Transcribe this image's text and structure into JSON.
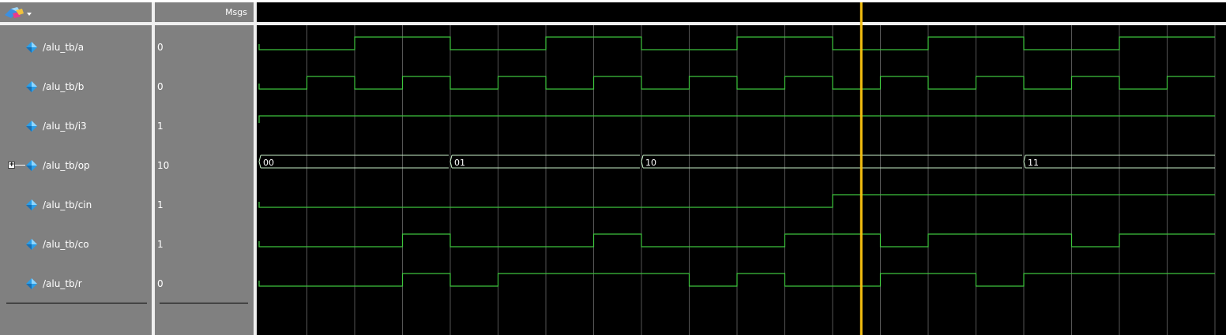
{
  "header": {
    "msgs_label": "Msgs"
  },
  "colors": {
    "wave": "#3ec43e",
    "cursor": "#f5bf10",
    "bus_line": "#c8f0c8",
    "grid": "#555555"
  },
  "time": {
    "start": 0,
    "end": 200,
    "cursor_time": 126,
    "grid_step": 10
  },
  "signals": [
    {
      "name": "/alu_tb/a",
      "value": "0",
      "type": "bit",
      "icon": "diamond-icon",
      "edges": [
        [
          0,
          0
        ],
        [
          20,
          1
        ],
        [
          40,
          0
        ],
        [
          60,
          1
        ],
        [
          80,
          0
        ],
        [
          100,
          1
        ],
        [
          120,
          0
        ],
        [
          140,
          1
        ],
        [
          160,
          0
        ],
        [
          180,
          1
        ]
      ]
    },
    {
      "name": "/alu_tb/b",
      "value": "0",
      "type": "bit",
      "icon": "diamond-icon",
      "edges": [
        [
          0,
          0
        ],
        [
          10,
          1
        ],
        [
          20,
          0
        ],
        [
          30,
          1
        ],
        [
          40,
          0
        ],
        [
          50,
          1
        ],
        [
          60,
          0
        ],
        [
          70,
          1
        ],
        [
          80,
          0
        ],
        [
          90,
          1
        ],
        [
          100,
          0
        ],
        [
          110,
          1
        ],
        [
          120,
          0
        ],
        [
          130,
          1
        ],
        [
          140,
          0
        ],
        [
          150,
          1
        ],
        [
          160,
          0
        ],
        [
          170,
          1
        ],
        [
          180,
          0
        ],
        [
          190,
          1
        ]
      ]
    },
    {
      "name": "/alu_tb/i3",
      "value": "1",
      "type": "bit",
      "icon": "diamond-icon",
      "edges": [
        [
          0,
          1
        ]
      ]
    },
    {
      "name": "/alu_tb/op",
      "value": "10",
      "type": "bus",
      "icon": "diamond-icon",
      "expandable": true,
      "segments": [
        [
          0,
          "00"
        ],
        [
          40,
          "01"
        ],
        [
          80,
          "10"
        ],
        [
          160,
          "11"
        ]
      ]
    },
    {
      "name": "/alu_tb/cin",
      "value": "1",
      "type": "bit",
      "icon": "diamond-icon",
      "edges": [
        [
          0,
          0
        ],
        [
          120,
          1
        ]
      ]
    },
    {
      "name": "/alu_tb/co",
      "value": "1",
      "type": "bit",
      "icon": "diamond-icon",
      "edges": [
        [
          0,
          0
        ],
        [
          30,
          1
        ],
        [
          40,
          0
        ],
        [
          70,
          1
        ],
        [
          80,
          0
        ],
        [
          110,
          1
        ],
        [
          130,
          0
        ],
        [
          140,
          1
        ],
        [
          170,
          0
        ],
        [
          180,
          1
        ]
      ]
    },
    {
      "name": "/alu_tb/r",
      "value": "0",
      "type": "bit",
      "icon": "diamond-icon",
      "edges": [
        [
          0,
          0
        ],
        [
          30,
          1
        ],
        [
          40,
          0
        ],
        [
          50,
          1
        ],
        [
          90,
          0
        ],
        [
          100,
          1
        ],
        [
          110,
          0
        ],
        [
          130,
          1
        ],
        [
          150,
          0
        ],
        [
          160,
          1
        ]
      ]
    }
  ]
}
